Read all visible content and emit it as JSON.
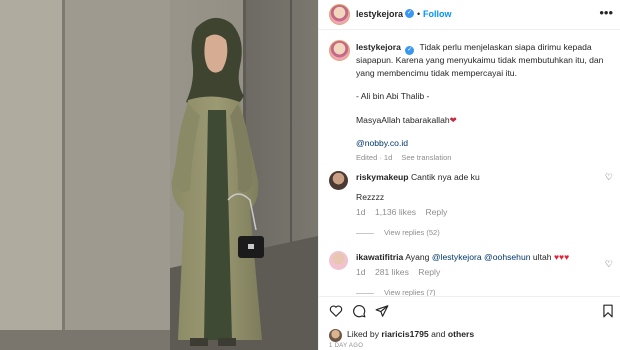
{
  "post": {
    "author": "lestykejora",
    "follow_label": "Follow",
    "more_label": "•••",
    "separator": "•"
  },
  "caption": {
    "username": "lestykejora",
    "line1": "Tidak perlu menjelaskan siapa dirimu kepada",
    "line2": "siapapun. Karena yang menyukaimu tidak membutuhkan itu, dan",
    "line3": "yang membencimu tidak mempercayai itu.",
    "attribution": "- Ali bin Abi Thalib -",
    "blessing": "MasyaAllah tabarakallah",
    "mention": "@nobby.co.id",
    "edited": "Edited · 1d",
    "see_translation": "See translation"
  },
  "comments": [
    {
      "username": "riskymakeup",
      "text": "Cantik nya ade ku",
      "text2": "Rezzzz",
      "age": "1d",
      "likes": "1,136 likes",
      "reply": "Reply",
      "view_replies": "View replies (52)"
    },
    {
      "username": "ikawatifitria",
      "text": "Ayang",
      "mention1": "@lestykejora",
      "mention2": "@oohsehun",
      "tail": "ultah",
      "hearts": "♥♥♥",
      "age": "1d",
      "likes": "281 likes",
      "reply": "Reply",
      "view_replies": "View replies (7)"
    }
  ],
  "likes": {
    "prefix": "Liked by",
    "user": "riaricis1795",
    "and": "and",
    "others": "others"
  },
  "date": "1 DAY AGO",
  "colors": {
    "accent": "#0095f6",
    "verified": "#3897f0",
    "muted": "#8e8e8e",
    "heart_red": "#e0243a"
  },
  "icons": [
    "heart-icon",
    "comment-icon",
    "share-icon",
    "bookmark-icon",
    "verified-badge-icon",
    "more-options-icon"
  ]
}
